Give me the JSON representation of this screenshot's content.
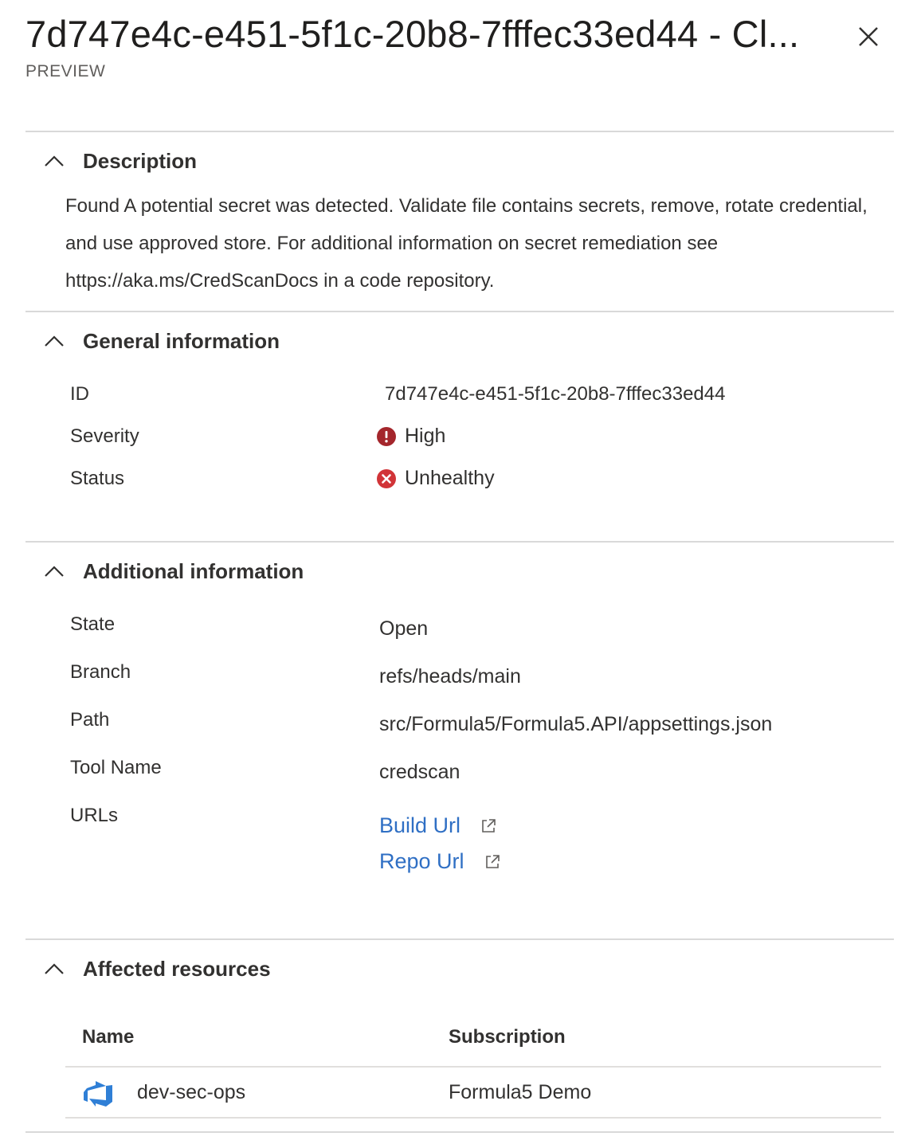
{
  "header": {
    "title": "7d747e4c-e451-5f1c-20b8-7fffec33ed44 - Cl...",
    "subtitle": "PREVIEW"
  },
  "sections": {
    "description": {
      "title": "Description",
      "body": "Found A potential secret was detected. Validate file contains secrets, remove, rotate credential, and use approved store. For additional information on secret remediation see https://aka.ms/CredScanDocs in a code repository."
    },
    "general": {
      "title": "General information",
      "id_label": "ID",
      "id_value": "7d747e4c-e451-5f1c-20b8-7fffec33ed44",
      "severity_label": "Severity",
      "severity_value": "High",
      "status_label": "Status",
      "status_value": "Unhealthy"
    },
    "additional": {
      "title": "Additional information",
      "state_label": "State",
      "state_value": "Open",
      "branch_label": "Branch",
      "branch_value": "refs/heads/main",
      "path_label": "Path",
      "path_value": "src/Formula5/Formula5.API/appsettings.json",
      "tool_label": "Tool Name",
      "tool_value": "credscan",
      "urls_label": "URLs",
      "build_url_label": "Build Url",
      "repo_url_label": "Repo Url"
    },
    "affected": {
      "title": "Affected resources",
      "columns": {
        "name": "Name",
        "subscription": "Subscription"
      },
      "rows": [
        {
          "name": "dev-sec-ops",
          "subscription": "Formula5 Demo"
        }
      ]
    }
  },
  "icons": {
    "close": "close-icon",
    "chevron": "chevron-up-icon",
    "severity": "exclamation-circle-icon",
    "status": "error-x-circle-icon",
    "external": "external-link-icon",
    "resource": "azure-devops-icon"
  },
  "colors": {
    "link": "#2f6fc4",
    "severity_high": "#a4262c",
    "status_error": "#d13438",
    "devops_blue": "#2f7fd6"
  }
}
